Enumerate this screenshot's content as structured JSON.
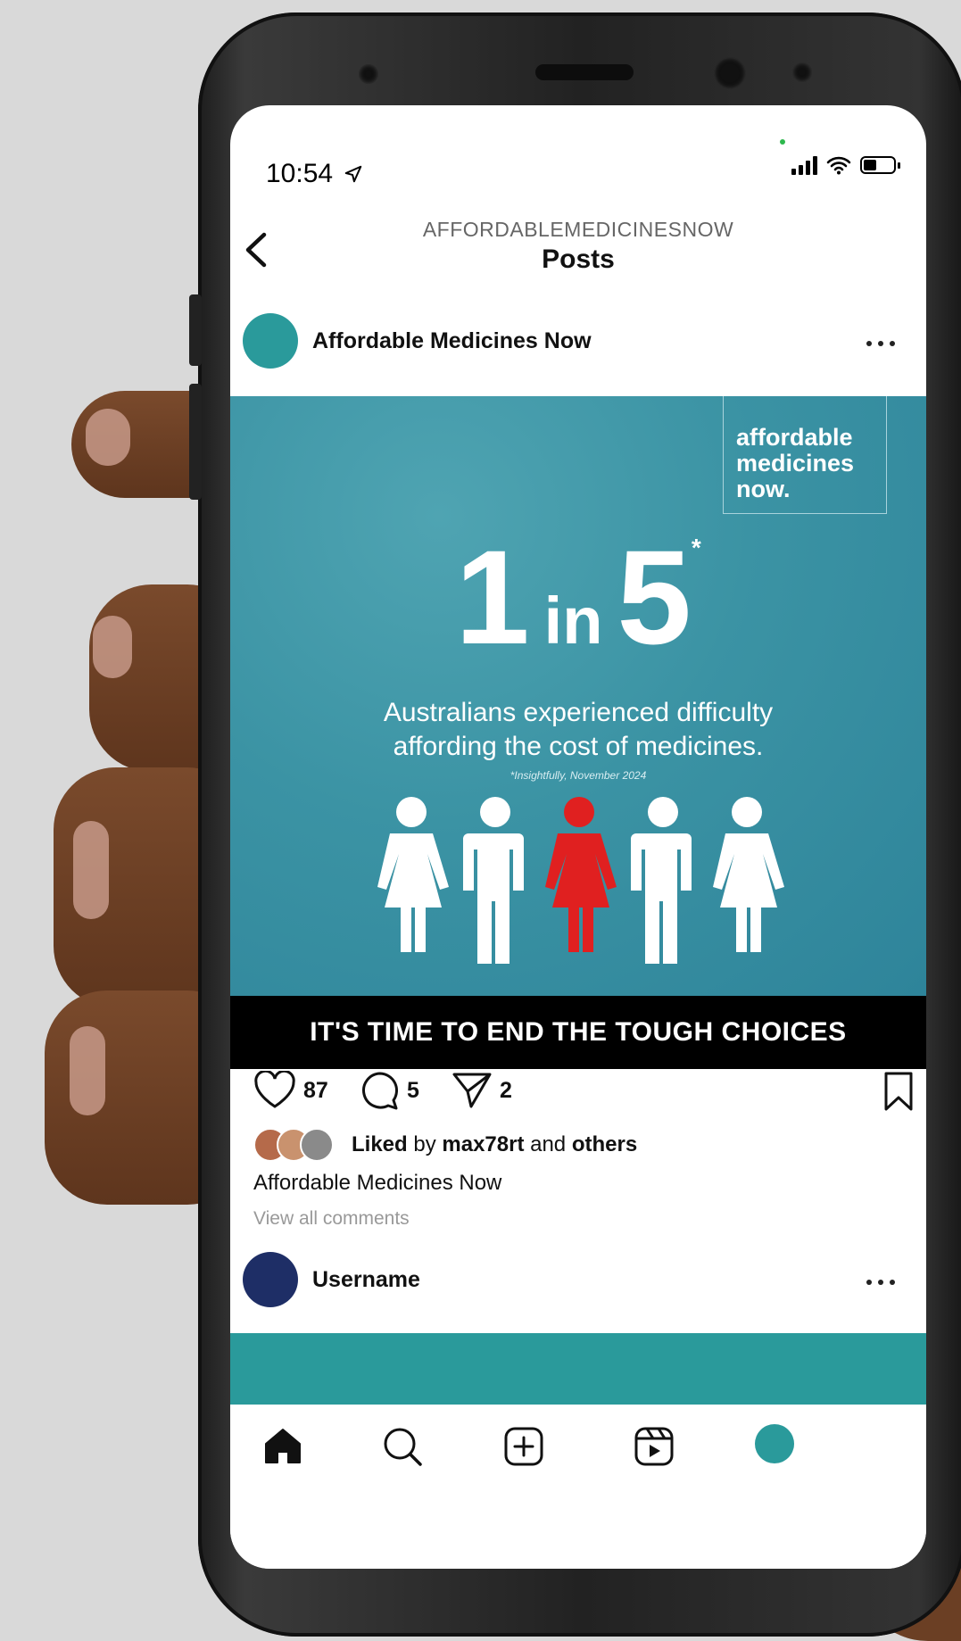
{
  "status_bar": {
    "time": "10:54"
  },
  "header": {
    "subtitle": "AFFORDABLEMEDICINESNOW",
    "title": "Posts"
  },
  "post": {
    "username": "Affordable Medicines Now",
    "graphic": {
      "brand": [
        "affordable",
        "medicines",
        "now."
      ],
      "stat_num1": "1",
      "stat_in": "in",
      "stat_num2": "5",
      "stat_mark": "*",
      "stat_line1": "Australians experienced difficulty",
      "stat_line2": "affording the cost of medicines.",
      "footnote": "*Insightfully, November 2024",
      "people_highlighted_index": 2,
      "people_total": 5,
      "highlight_color": "#e02020",
      "banner": "IT'S TIME TO END THE TOUGH CHOICES"
    },
    "likes_count": "87",
    "comments_count": "5",
    "shares_count": "2",
    "liked_by_prefix": "Liked",
    "liked_by_mid": " by ",
    "liked_by_user": "max78rt",
    "liked_by_and": " and ",
    "liked_by_others": "others",
    "caption": "Affordable Medicines Now",
    "view_comments": "View all comments"
  },
  "next_post": {
    "username": "Username"
  },
  "colors": {
    "brand_teal": "#2a9a9b",
    "next_avatar": "#1e2e66"
  },
  "nav": [
    "home-icon",
    "search-icon",
    "add-post-icon",
    "reels-icon",
    "profile-avatar"
  ]
}
